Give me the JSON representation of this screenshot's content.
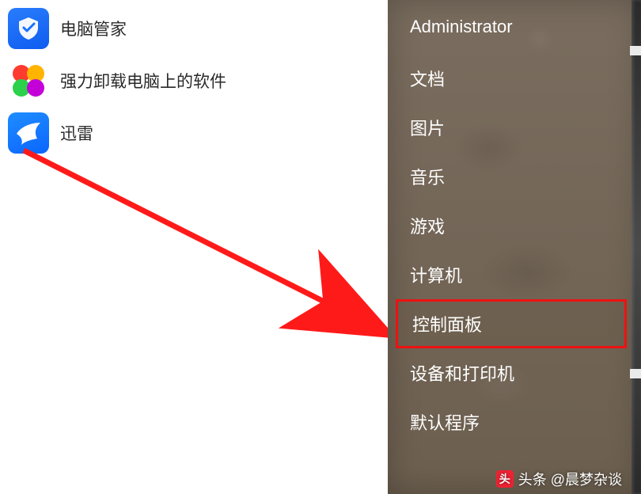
{
  "programs": [
    {
      "id": "pc-manager",
      "label": "电脑管家",
      "icon": "shield-icon"
    },
    {
      "id": "uninstaller",
      "label": "强力卸载电脑上的软件",
      "icon": "petals-icon"
    },
    {
      "id": "xunlei",
      "label": "迅雷",
      "icon": "bird-icon"
    }
  ],
  "menu": {
    "items": [
      {
        "id": "administrator",
        "label": "Administrator",
        "highlight": false
      },
      {
        "id": "documents",
        "label": "文档",
        "highlight": false
      },
      {
        "id": "pictures",
        "label": "图片",
        "highlight": false
      },
      {
        "id": "music",
        "label": "音乐",
        "highlight": false
      },
      {
        "id": "games",
        "label": "游戏",
        "highlight": false
      },
      {
        "id": "computer",
        "label": "计算机",
        "highlight": false
      },
      {
        "id": "control-panel",
        "label": "控制面板",
        "highlight": true
      },
      {
        "id": "devices-printers",
        "label": "设备和打印机",
        "highlight": false
      },
      {
        "id": "default-programs",
        "label": "默认程序",
        "highlight": false
      }
    ]
  },
  "annotation": {
    "arrow_color": "#ff1a1a",
    "highlight_color": "#ee1111"
  },
  "watermark": {
    "badge": "头",
    "text": "头条 @晨梦杂谈"
  }
}
